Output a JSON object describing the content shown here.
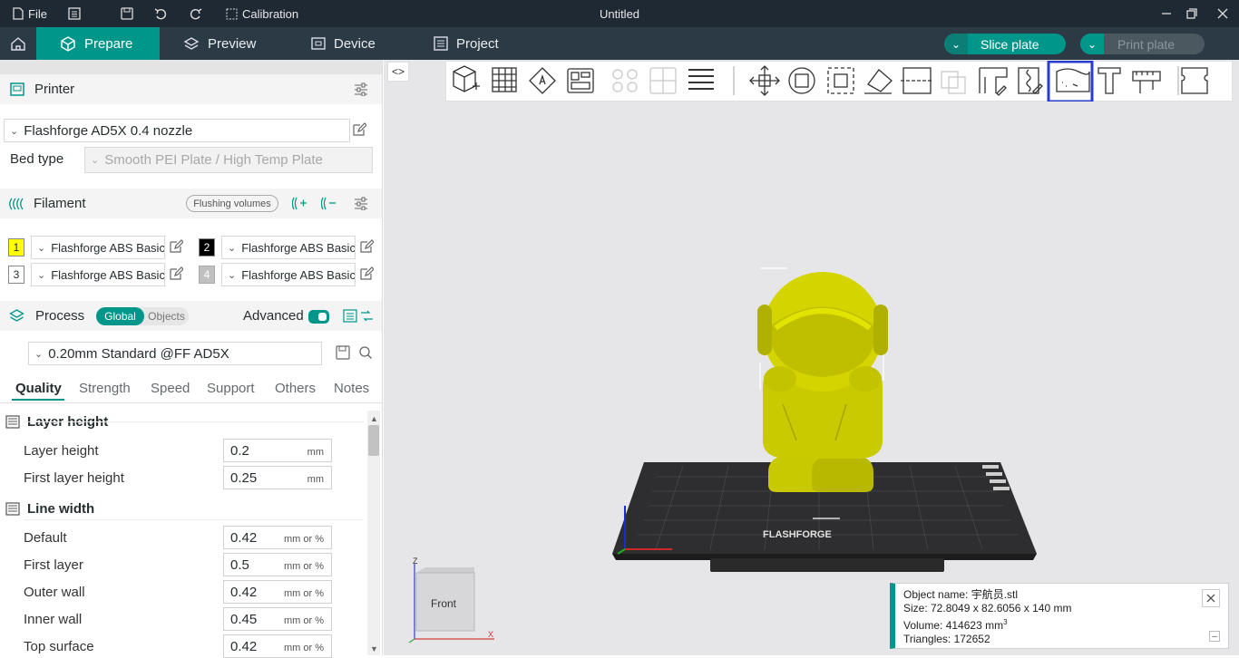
{
  "titlebar": {
    "file": "File",
    "calibration": "Calibration",
    "window_title": "Untitled"
  },
  "nav": {
    "prepare": "Prepare",
    "preview": "Preview",
    "device": "Device",
    "project": "Project",
    "slice_plate": "Slice plate",
    "print_plate": "Print plate"
  },
  "printer": {
    "heading": "Printer",
    "selected": "Flashforge AD5X 0.4 nozzle",
    "bed_type_label": "Bed type",
    "bed_type_value": "Smooth PEI Plate / High Temp Plate"
  },
  "filament": {
    "heading": "Filament",
    "flushing_button": "Flushing volumes",
    "slots": [
      {
        "num": "1",
        "name": "Flashforge ABS Basic",
        "color": "#ffff00"
      },
      {
        "num": "2",
        "name": "Flashforge ABS Basic",
        "color": "#000000"
      },
      {
        "num": "3",
        "name": "Flashforge ABS Basic",
        "color": "#ffffff"
      },
      {
        "num": "4",
        "name": "Flashforge ABS Basic",
        "color": "#c0c0c0"
      }
    ]
  },
  "process": {
    "heading": "Process",
    "global": "Global",
    "objects": "Objects",
    "advanced": "Advanced",
    "preset": "0.20mm Standard @FF AD5X",
    "tabs": [
      "Quality",
      "Strength",
      "Speed",
      "Support",
      "Others",
      "Notes"
    ]
  },
  "settings": {
    "layer_height_group": "Layer height",
    "layer_height_label": "Layer height",
    "layer_height_value": "0.2",
    "first_layer_height_label": "First layer height",
    "first_layer_height_value": "0.25",
    "unit_mm": "mm",
    "line_width_group": "Line width",
    "unit_mm_pct": "mm or %",
    "line_widths": [
      {
        "label": "Default",
        "value": "0.42"
      },
      {
        "label": "First layer",
        "value": "0.5"
      },
      {
        "label": "Outer wall",
        "value": "0.42"
      },
      {
        "label": "Inner wall",
        "value": "0.45"
      },
      {
        "label": "Top surface",
        "value": "0.42"
      }
    ]
  },
  "viewport": {
    "view_cube_label": "Front",
    "bed_brand": "FLASHFORGE",
    "axis_z": "Z",
    "axis_x": "X"
  },
  "object_info": {
    "name": "Object name: 宇航员.stl",
    "size": "Size: 72.8049 x 82.6056 x 140 mm",
    "volume_prefix": "Volume: 414623 mm",
    "volume_sup": "3",
    "triangles": "Triangles: 172652"
  },
  "colors": {
    "accent": "#00968a",
    "titlebar": "#1f2933",
    "navbar": "#2b3a44",
    "model": "#d6d600",
    "highlight": "#2a3bd0"
  }
}
